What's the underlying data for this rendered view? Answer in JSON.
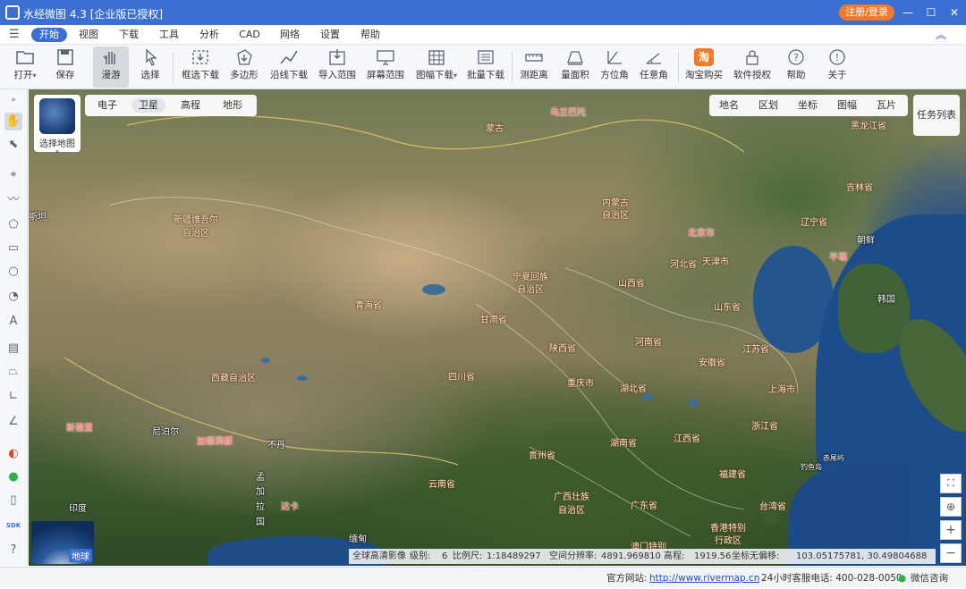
{
  "app": {
    "title": "水经微图 4.3 [企业版已授权]",
    "login_label": "注册/登录"
  },
  "window_controls": {
    "minimize": "—",
    "maximize": "☐",
    "close": "✕"
  },
  "menu": {
    "tabs": [
      {
        "label": "开始",
        "active": true
      },
      {
        "label": "视图"
      },
      {
        "label": "下载"
      },
      {
        "label": "工具"
      },
      {
        "label": "分析"
      },
      {
        "label": "CAD"
      },
      {
        "label": "网络"
      },
      {
        "label": "设置"
      },
      {
        "label": "帮助"
      }
    ]
  },
  "toolbar": {
    "open": "打开",
    "save": "保存",
    "pan": "漫游",
    "select": "选择",
    "frame_download": "框选下载",
    "polygon": "多边形",
    "line_download": "沿线下载",
    "import_range": "导入范围",
    "screen_range": "屏幕范围",
    "sheet_download": "图幅下载",
    "batch_download": "批量下载",
    "measure_distance": "测距离",
    "measure_area": "量面积",
    "bearing": "方位角",
    "any_angle": "任意角",
    "taobao": "淘宝购买",
    "license": "软件授权",
    "help": "帮助",
    "about": "关于",
    "taobao_icon_text": "淘"
  },
  "map": {
    "selector_label": "选择地图",
    "base_layers": [
      "电子",
      "卫星",
      "高程",
      "地形"
    ],
    "active_layer": "卫星",
    "overlay_layers": [
      "地名",
      "区划",
      "坐标",
      "图幅",
      "瓦片"
    ],
    "task_list": "任务列表",
    "globe_label": "地球",
    "places": {
      "mongolia": "蒙古",
      "ulaanbaatar": "乌兰巴托",
      "heilongjiang": "黑龙江省",
      "jilin": "吉林省",
      "liaoning": "辽宁省",
      "neimenggu1": "内蒙古",
      "neimenggu2": "自治区",
      "beijing": "北京市",
      "tianjin": "天津市",
      "hebei": "河北省",
      "nk": "朝鲜",
      "pyongyang": "平壤",
      "sk": "韩国",
      "xinjiang1": "新疆维吾尔",
      "xinjiang2": "自治区",
      "kazakh": "斯坦",
      "ningxia1": "宁夏回族",
      "ningxia2": "自治区",
      "shanxi": "山西省",
      "shandong": "山东省",
      "qinghai": "青海省",
      "gansu": "甘肃省",
      "shaanxi": "陕西省",
      "henan": "河南省",
      "jiangsu": "江苏省",
      "anhui": "安徽省",
      "shanghai": "上海市",
      "sichuan": "四川省",
      "chongqing": "重庆市",
      "hubei": "湖北省",
      "tibet": "西藏自治区",
      "zhejiang": "浙江省",
      "nepal": "尼泊尔",
      "newdelhi": "新德里",
      "kathmandu": "加德满都",
      "bhutan": "不丹",
      "hunan": "湖南省",
      "jiangxi": "江西省",
      "guizhou": "贵州省",
      "yunnan": "云南省",
      "fujian": "福建省",
      "bangla1": "孟",
      "bangla2": "加",
      "bangla3": "拉",
      "bangla4": "国",
      "dhaka": "达卡",
      "guangxi1": "广西壮族",
      "guangxi2": "自治区",
      "guangdong": "广东省",
      "taiwan": "台湾省",
      "india": "印度",
      "myanmar": "缅甸",
      "hongkong1": "香港特别",
      "hongkong2": "行政区",
      "macau": "澳门特别",
      "chiwei": "赤尾屿",
      "diaoyu": "钓鱼岛"
    }
  },
  "status": {
    "imagery": "全球高清影像",
    "level_label": "级别:",
    "level": "6",
    "scale_label": "比例尺:",
    "scale": "1:18489297",
    "resolution_label": "空间分辨率:",
    "resolution": "4891.969810",
    "elevation_label": "高程:",
    "elevation": "1919.56",
    "coord_label": "坐标无偏移:",
    "coords": "103.05175781, 30.49804688"
  },
  "footer": {
    "site_label": "官方网站:",
    "site_url": "http://www.rivermap.cn",
    "hotline": "24小时客服电话: 400-028-0050",
    "wechat": "微信咨询"
  }
}
